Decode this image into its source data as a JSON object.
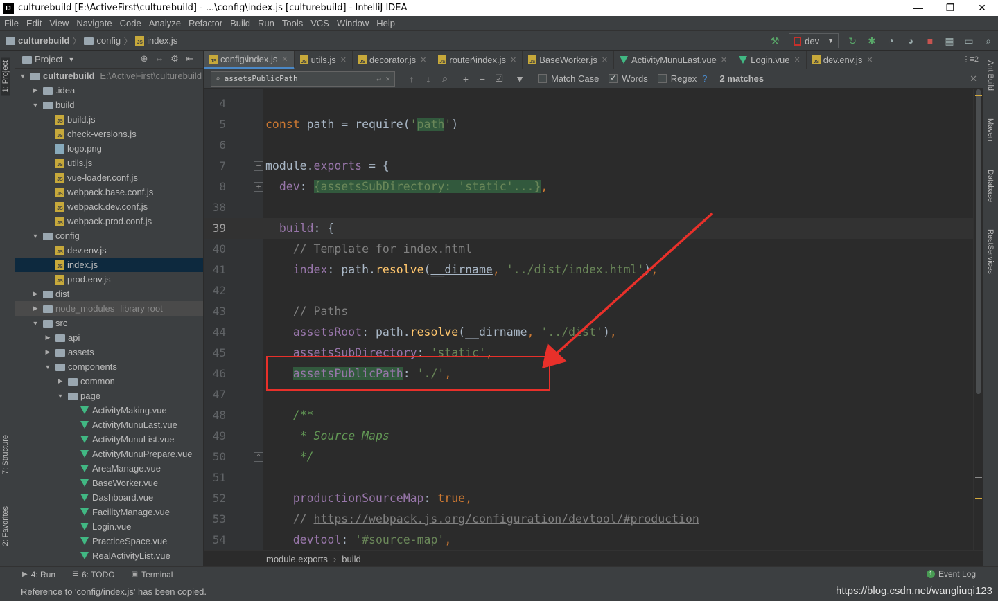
{
  "window": {
    "title": "culturebuild [E:\\ActiveFirst\\culturebuild] - ...\\config\\index.js [culturebuild] - IntelliJ IDEA",
    "app_icon": "IJ"
  },
  "menu": [
    "File",
    "Edit",
    "View",
    "Navigate",
    "Code",
    "Analyze",
    "Refactor",
    "Build",
    "Run",
    "Tools",
    "VCS",
    "Window",
    "Help"
  ],
  "breadcrumb": [
    "culturebuild",
    "config",
    "index.js"
  ],
  "run_config": "dev",
  "left_tabs": {
    "project": "1: Project",
    "structure": "7: Structure",
    "favorites": "2: Favorites"
  },
  "right_tabs": [
    "Ant Build",
    "Maven",
    "Database",
    "RestServices"
  ],
  "project": {
    "title": "Project",
    "tree": [
      {
        "label": "culturebuild",
        "path": "E:\\ActiveFirst\\culturebuild",
        "type": "folder",
        "depth": 0,
        "arrow": "open",
        "bold": true
      },
      {
        "label": ".idea",
        "type": "folder",
        "depth": 1,
        "arrow": "closed"
      },
      {
        "label": "build",
        "type": "folder",
        "depth": 1,
        "arrow": "open"
      },
      {
        "label": "build.js",
        "type": "js",
        "depth": 2
      },
      {
        "label": "check-versions.js",
        "type": "js",
        "depth": 2
      },
      {
        "label": "logo.png",
        "type": "png",
        "depth": 2
      },
      {
        "label": "utils.js",
        "type": "js",
        "depth": 2
      },
      {
        "label": "vue-loader.conf.js",
        "type": "js",
        "depth": 2
      },
      {
        "label": "webpack.base.conf.js",
        "type": "js",
        "depth": 2
      },
      {
        "label": "webpack.dev.conf.js",
        "type": "js",
        "depth": 2
      },
      {
        "label": "webpack.prod.conf.js",
        "type": "js",
        "depth": 2
      },
      {
        "label": "config",
        "type": "folder",
        "depth": 1,
        "arrow": "open"
      },
      {
        "label": "dev.env.js",
        "type": "js",
        "depth": 2
      },
      {
        "label": "index.js",
        "type": "js",
        "depth": 2,
        "selected": true
      },
      {
        "label": "prod.env.js",
        "type": "js",
        "depth": 2
      },
      {
        "label": "dist",
        "type": "folder",
        "depth": 1,
        "arrow": "closed"
      },
      {
        "label": "node_modules",
        "path": "library root",
        "type": "folder",
        "depth": 1,
        "arrow": "closed",
        "lib": true
      },
      {
        "label": "src",
        "type": "folder",
        "depth": 1,
        "arrow": "open"
      },
      {
        "label": "api",
        "type": "folder",
        "depth": 2,
        "arrow": "closed"
      },
      {
        "label": "assets",
        "type": "folder",
        "depth": 2,
        "arrow": "closed"
      },
      {
        "label": "components",
        "type": "folder",
        "depth": 2,
        "arrow": "open"
      },
      {
        "label": "common",
        "type": "folder",
        "depth": 3,
        "arrow": "closed"
      },
      {
        "label": "page",
        "type": "folder",
        "depth": 3,
        "arrow": "open"
      },
      {
        "label": "ActivityMaking.vue",
        "type": "vue",
        "depth": 4
      },
      {
        "label": "ActivityMunuLast.vue",
        "type": "vue",
        "depth": 4
      },
      {
        "label": "ActivityMunuList.vue",
        "type": "vue",
        "depth": 4
      },
      {
        "label": "ActivityMunuPrepare.vue",
        "type": "vue",
        "depth": 4
      },
      {
        "label": "AreaManage.vue",
        "type": "vue",
        "depth": 4
      },
      {
        "label": "BaseWorker.vue",
        "type": "vue",
        "depth": 4
      },
      {
        "label": "Dashboard.vue",
        "type": "vue",
        "depth": 4
      },
      {
        "label": "FacilityManage.vue",
        "type": "vue",
        "depth": 4
      },
      {
        "label": "Login.vue",
        "type": "vue",
        "depth": 4
      },
      {
        "label": "PracticeSpace.vue",
        "type": "vue",
        "depth": 4
      },
      {
        "label": "RealActivityList.vue",
        "type": "vue",
        "depth": 4
      }
    ]
  },
  "tabs": [
    {
      "label": "config\\index.js",
      "type": "js",
      "active": true
    },
    {
      "label": "utils.js",
      "type": "js"
    },
    {
      "label": "decorator.js",
      "type": "js"
    },
    {
      "label": "router\\index.js",
      "type": "js"
    },
    {
      "label": "BaseWorker.js",
      "type": "js"
    },
    {
      "label": "ActivityMunuLast.vue",
      "type": "vue"
    },
    {
      "label": "Login.vue",
      "type": "vue"
    },
    {
      "label": "dev.env.js",
      "type": "js"
    }
  ],
  "tabs_more": "⋮≡2",
  "find": {
    "query": "assetsPublicPath",
    "match_case_label": "Match Case",
    "words_label": "Words",
    "regex_label": "Regex",
    "help": "?",
    "match_case": false,
    "words": true,
    "regex": false,
    "matches": "2 matches"
  },
  "code_lines": [
    {
      "n": "4",
      "fold": "",
      "parts": []
    },
    {
      "n": "5",
      "fold": "",
      "parts": [
        [
          "k",
          "const "
        ],
        [
          "w",
          "path "
        ],
        [
          "w",
          "= "
        ],
        [
          "u",
          "require"
        ],
        [
          "w",
          "("
        ],
        [
          "s",
          "'"
        ],
        [
          "hs",
          "path"
        ],
        [
          "s",
          "'"
        ],
        [
          "w",
          ")"
        ]
      ]
    },
    {
      "n": "6",
      "fold": "",
      "parts": []
    },
    {
      "n": "7",
      "fold": "v",
      "parts": [
        [
          "w",
          "module"
        ],
        [
          "w",
          "."
        ],
        [
          "p",
          "exports"
        ],
        [
          "w",
          " = {"
        ]
      ]
    },
    {
      "n": "8",
      "fold": "+",
      "parts": [
        [
          "w",
          "  "
        ],
        [
          "p",
          "dev"
        ],
        [
          "w",
          ": "
        ],
        [
          "hl",
          "{assetsSubDirectory: 'static'...}"
        ],
        [
          "k",
          ","
        ]
      ]
    },
    {
      "n": "38",
      "fold": "",
      "parts": []
    },
    {
      "n": "39",
      "fold": "v",
      "cur": true,
      "parts": [
        [
          "w",
          "  "
        ],
        [
          "p",
          "build"
        ],
        [
          "w",
          ": {"
        ]
      ]
    },
    {
      "n": "40",
      "fold": "",
      "parts": [
        [
          "c",
          "    // Template for index.html"
        ]
      ]
    },
    {
      "n": "41",
      "fold": "",
      "parts": [
        [
          "w",
          "    "
        ],
        [
          "p",
          "index"
        ],
        [
          "w",
          ": path."
        ],
        [
          "f",
          "resolve"
        ],
        [
          "w",
          "("
        ],
        [
          "u",
          "__dirname"
        ],
        [
          "k",
          ", "
        ],
        [
          "s",
          "'../dist/index.html'"
        ],
        [
          "w",
          ")"
        ],
        [
          "k",
          ","
        ]
      ]
    },
    {
      "n": "42",
      "fold": "",
      "parts": []
    },
    {
      "n": "43",
      "fold": "",
      "parts": [
        [
          "c",
          "    // Paths"
        ]
      ]
    },
    {
      "n": "44",
      "fold": "",
      "parts": [
        [
          "w",
          "    "
        ],
        [
          "p",
          "assetsRoot"
        ],
        [
          "w",
          ": path."
        ],
        [
          "f",
          "resolve"
        ],
        [
          "w",
          "("
        ],
        [
          "u",
          "__dirname"
        ],
        [
          "k",
          ", "
        ],
        [
          "s",
          "'../dist'"
        ],
        [
          "w",
          ")"
        ],
        [
          "k",
          ","
        ]
      ]
    },
    {
      "n": "45",
      "fold": "",
      "parts": [
        [
          "w",
          "    "
        ],
        [
          "p",
          "assetsSubDirectory"
        ],
        [
          "w",
          ": "
        ],
        [
          "s",
          "'static'"
        ],
        [
          "k",
          ","
        ]
      ]
    },
    {
      "n": "46",
      "fold": "",
      "parts": [
        [
          "w",
          "    "
        ],
        [
          "hp",
          "assetsPublicPath"
        ],
        [
          "w",
          ": "
        ],
        [
          "s",
          "'./'"
        ],
        [
          "k",
          ","
        ]
      ]
    },
    {
      "n": "47",
      "fold": "",
      "parts": []
    },
    {
      "n": "48",
      "fold": "v",
      "parts": [
        [
          "ci",
          "    /**"
        ]
      ]
    },
    {
      "n": "49",
      "fold": "",
      "parts": [
        [
          "ci",
          "     * Source Maps"
        ]
      ]
    },
    {
      "n": "50",
      "fold": "^",
      "parts": [
        [
          "ci",
          "     */"
        ]
      ]
    },
    {
      "n": "51",
      "fold": "",
      "parts": []
    },
    {
      "n": "52",
      "fold": "",
      "parts": [
        [
          "w",
          "    "
        ],
        [
          "p",
          "productionSourceMap"
        ],
        [
          "w",
          ": "
        ],
        [
          "k",
          "true"
        ],
        [
          "k",
          ","
        ]
      ]
    },
    {
      "n": "53",
      "fold": "",
      "parts": [
        [
          "c",
          "    // "
        ],
        [
          "url",
          "https://webpack.js.org/configuration/devtool/#production"
        ]
      ]
    },
    {
      "n": "54",
      "fold": "",
      "parts": [
        [
          "w",
          "    "
        ],
        [
          "p",
          "devtool"
        ],
        [
          "w",
          ": "
        ],
        [
          "s",
          "'#source-map'"
        ],
        [
          "k",
          ","
        ]
      ]
    }
  ],
  "editor_breadcrumb": [
    "module.exports",
    "build"
  ],
  "bottom_tools": [
    {
      "label": "4: Run",
      "icon": "run-icon"
    },
    {
      "label": "6: TODO",
      "icon": "todo-icon"
    },
    {
      "label": "Terminal",
      "icon": "terminal-icon"
    }
  ],
  "event_log": "Event Log",
  "status": "Reference to 'config/index.js' has been copied.",
  "watermark": "https://blog.csdn.net/wangliuqi123",
  "colors": {
    "annotation": "#e8302a",
    "keyword": "#cc7832",
    "string": "#6a8759",
    "property": "#9876aa",
    "function": "#ffc66d"
  }
}
